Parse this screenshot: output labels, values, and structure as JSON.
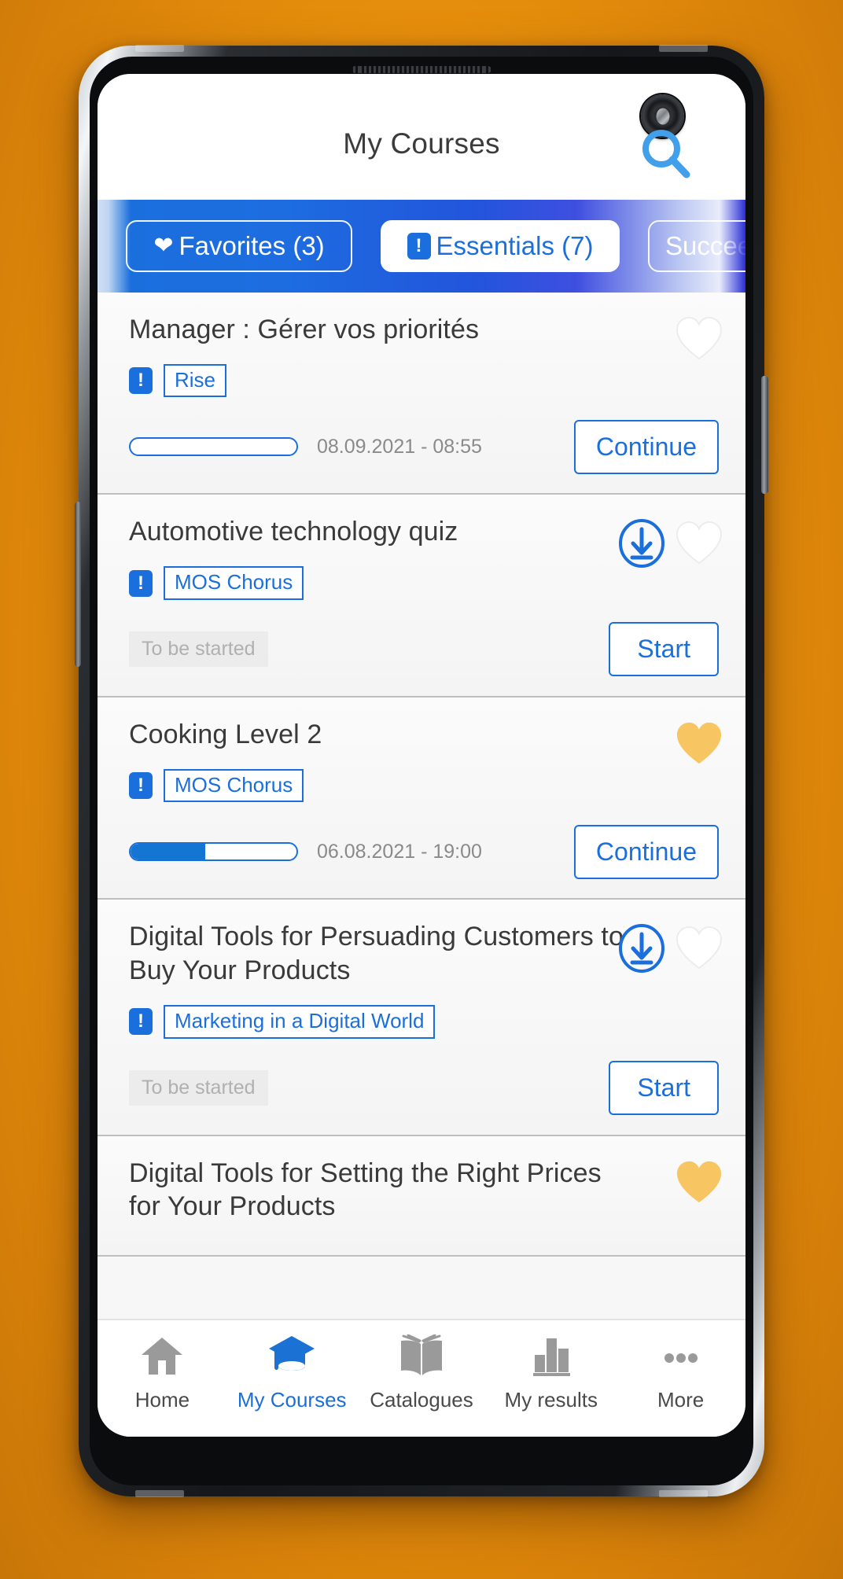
{
  "header": {
    "title": "My Courses",
    "search_icon": "search-icon",
    "camera_icon": "front-camera-punch-hole"
  },
  "tabs": [
    {
      "id": "favorites",
      "icon": "heart-icon",
      "label": "Favorites (3)",
      "selected": false
    },
    {
      "id": "essentials",
      "icon": "exclamation-icon",
      "label": "Essentials (7)",
      "selected": true
    },
    {
      "id": "success",
      "icon": "none",
      "label": "Succee",
      "selected": false
    }
  ],
  "courses": [
    {
      "title": "Manager : Gérer vos priorités",
      "tag": "Rise",
      "tag_icon": "exclamation-icon",
      "favorite": false,
      "downloadable": false,
      "progress_percent": 0,
      "date": "08.09.2021  -  08:55",
      "status": "",
      "action_label": "Continue"
    },
    {
      "title": "Automotive technology quiz",
      "tag": "MOS Chorus",
      "tag_icon": "exclamation-icon",
      "favorite": false,
      "downloadable": true,
      "progress_percent": null,
      "date": "",
      "status": "To be started",
      "action_label": "Start"
    },
    {
      "title": "Cooking Level 2",
      "tag": "MOS Chorus",
      "tag_icon": "exclamation-icon",
      "favorite": true,
      "downloadable": false,
      "progress_percent": 45,
      "date": "06.08.2021  -  19:00",
      "status": "",
      "action_label": "Continue"
    },
    {
      "title": "Digital Tools for Persuading Customers to Buy Your Products",
      "tag": "Marketing in a Digital World",
      "tag_icon": "exclamation-icon",
      "favorite": false,
      "downloadable": true,
      "progress_percent": null,
      "date": "",
      "status": "To be started",
      "action_label": "Start"
    },
    {
      "title": "Digital Tools for Setting the Right Prices for Your Products",
      "tag": "",
      "tag_icon": "",
      "favorite": true,
      "downloadable": false,
      "progress_percent": null,
      "date": "",
      "status": "",
      "action_label": ""
    }
  ],
  "bottom_nav": [
    {
      "id": "home",
      "icon": "home-icon",
      "label": "Home",
      "active": false
    },
    {
      "id": "my-courses",
      "icon": "graduation-cap-icon",
      "label": "My Courses",
      "active": true
    },
    {
      "id": "catalogues",
      "icon": "open-book-icon",
      "label": "Catalogues",
      "active": false
    },
    {
      "id": "my-results",
      "icon": "bar-chart-icon",
      "label": "My results",
      "active": false
    },
    {
      "id": "more",
      "icon": "ellipsis-icon",
      "label": "More",
      "active": false
    }
  ],
  "colors": {
    "accent_blue": "#1b6fdd",
    "favorite_yellow": "#f7c561",
    "background_orange": "#e8900c",
    "muted_gray": "#b0b0b0"
  }
}
